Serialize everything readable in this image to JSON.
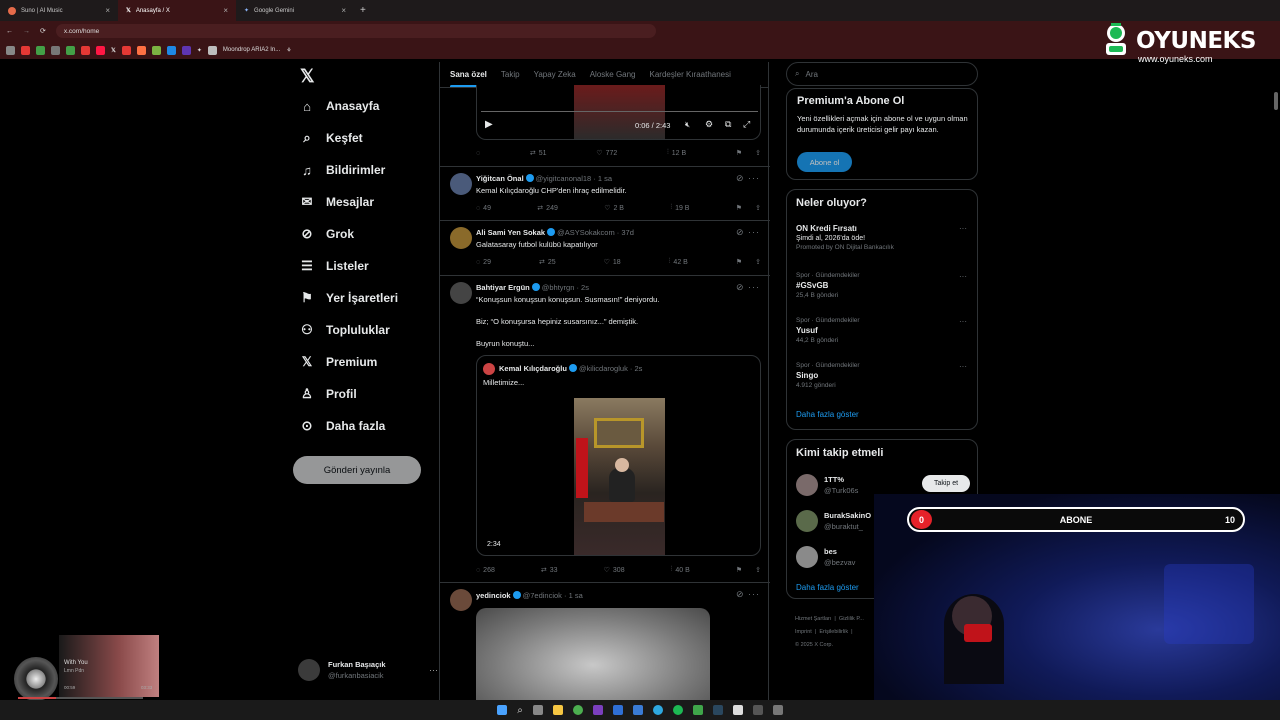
{
  "browser": {
    "tabs": [
      {
        "label": "Suno | AI Music"
      },
      {
        "label": "Anasayfa / X"
      },
      {
        "label": "Google Gemini"
      }
    ],
    "url": "x.com/home",
    "bookmark_label": "Moondrop ARIA2 In..."
  },
  "overlay": {
    "brand_name": "OYUNEKS",
    "brand_url": "www.oyuneks.com",
    "sub_goal": {
      "current": "0",
      "label": "ABONE",
      "target": "10"
    },
    "music": {
      "title": "With You",
      "artist": "Lmn Pdn",
      "elapsed": "00:59",
      "total": "03:33"
    }
  },
  "sidebar": {
    "items": [
      {
        "label": "Anasayfa",
        "icon": "home-icon"
      },
      {
        "label": "Keşfet",
        "icon": "search-icon"
      },
      {
        "label": "Bildirimler",
        "icon": "bell-icon"
      },
      {
        "label": "Mesajlar",
        "icon": "mail-icon"
      },
      {
        "label": "Grok",
        "icon": "grok-icon"
      },
      {
        "label": "Listeler",
        "icon": "list-icon"
      },
      {
        "label": "Yer İşaretleri",
        "icon": "bookmark-icon"
      },
      {
        "label": "Topluluklar",
        "icon": "people-icon"
      },
      {
        "label": "Premium",
        "icon": "x-icon"
      },
      {
        "label": "Profil",
        "icon": "person-icon"
      },
      {
        "label": "Daha fazla",
        "icon": "more-icon"
      }
    ],
    "post_button": "Gönderi yayınla",
    "account": {
      "name": "Furkan Başıaçık",
      "handle": "@furkanbasiacik"
    }
  },
  "feed": {
    "tabs": [
      "Sana özel",
      "Takip",
      "Yapay Zeka",
      "Aloske Gang",
      "Kardeşler Kıraathanesi"
    ],
    "video_time": "0:06 / 2:43",
    "first_actions": {
      "retweets": "51",
      "likes": "772",
      "views": "12 B"
    },
    "tweets": [
      {
        "name": "Yiğitcan Önal",
        "handle": "@yigitcanonal18 · 1 sa",
        "text": "Kemal Kılıçdaroğlu CHP'den ihraç edilmelidir.",
        "replies": "49",
        "retweets": "249",
        "likes": "2 B",
        "views": "19 B"
      },
      {
        "name": "Ali Sami Yen Sokak",
        "handle": "@ASYSokakcom · 37d",
        "text": "Galatasaray futbol kulübü kapatılıyor",
        "replies": "29",
        "retweets": "25",
        "likes": "18",
        "views": "42 B"
      },
      {
        "name": "Bahtiyar Ergün",
        "handle": "@bhtyrgn · 2s",
        "text1": "“Konuşsun konuşsun konuşsun. Susmasın!” deniyordu.",
        "text2": "Biz; “O konuşursa hepiniz susarsınız...” demiştik.",
        "text3": "Buyrun konuştu...",
        "quote_name": "Kemal Kılıçdaroğlu",
        "quote_handle": "@kilicdarogluk · 2s",
        "quote_text": "Milletimize...",
        "quote_duration": "2:34",
        "replies": "268",
        "retweets": "33",
        "likes": "308",
        "views": "40 B"
      },
      {
        "name": "yedinciok",
        "handle": "@7edinciok · 1 sa"
      }
    ]
  },
  "right": {
    "search_placeholder": "Ara",
    "premium": {
      "title": "Premium'a Abone Ol",
      "body": "Yeni özellikleri açmak için abone ol ve uygun olman durumunda içerik üreticisi gelir payı kazan.",
      "button": "Abone ol"
    },
    "trends_title": "Neler oluyor?",
    "promo": {
      "title": "ON Kredi Fırsatı",
      "sub": "Şimdi al, 2026'da öde!",
      "by": "Promoted by ON Dijital Bankacılık"
    },
    "trends": [
      {
        "category": "Spor · Gündemdekiler",
        "name": "#GSvGB",
        "count": "25,4 B gönderi"
      },
      {
        "category": "Spor · Gündemdekiler",
        "name": "Yusuf",
        "count": "44,2 B gönderi"
      },
      {
        "category": "Spor · Gündemdekiler",
        "name": "Singo",
        "count": "4.912 gönderi"
      }
    ],
    "show_more": "Daha fazla göster",
    "follow_title": "Kimi takip etmeli",
    "follow_button": "Takip et",
    "follows": [
      {
        "name": "1TT%",
        "handle": "@Turk06s"
      },
      {
        "name": "BurakSakinO",
        "handle": "@buraktut_"
      },
      {
        "name": "bes",
        "handle": "@bezvav"
      }
    ],
    "footer": [
      "Hizmet Şartları",
      "Gizlilik P...",
      "Imprint",
      "Erişilebilirlik",
      "© 2025 X Corp."
    ]
  }
}
